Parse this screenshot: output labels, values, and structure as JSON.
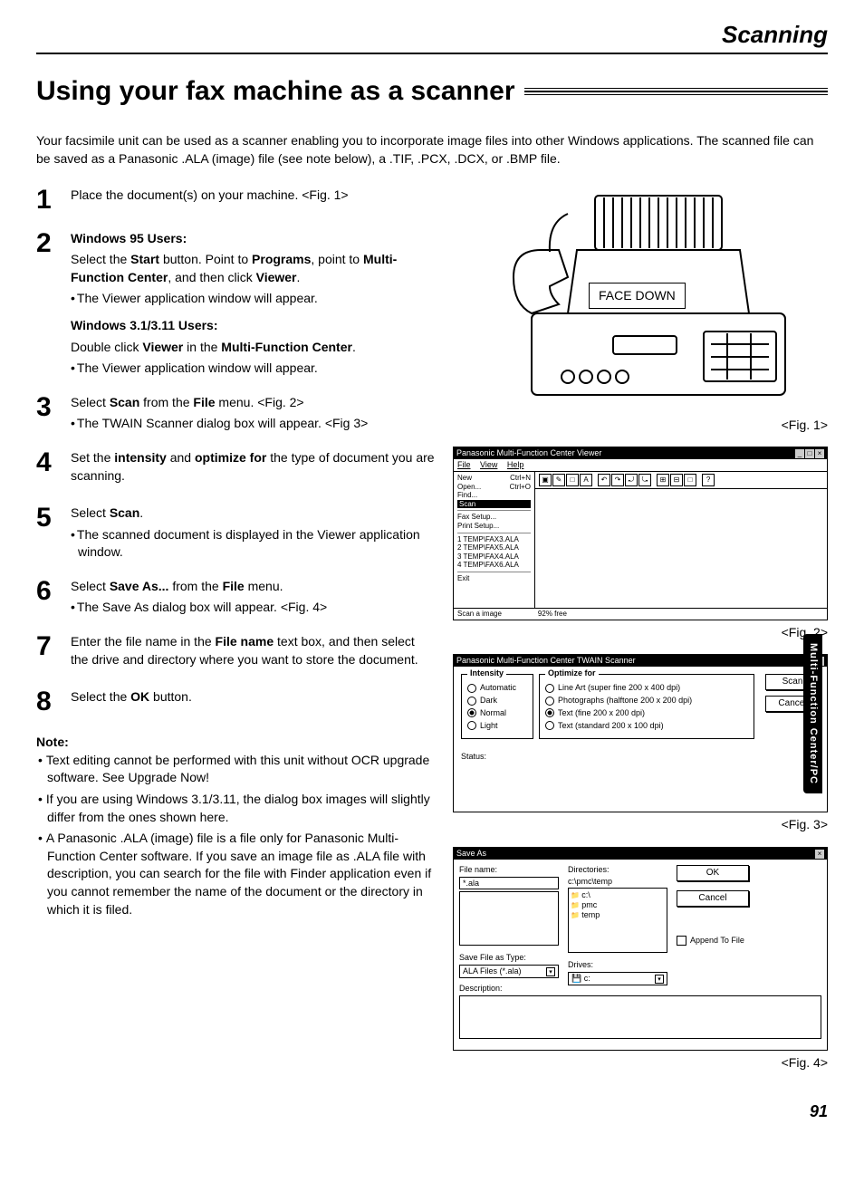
{
  "section_header": "Scanning",
  "page_title": "Using your fax machine as a scanner",
  "intro": "Your facsimile unit can be used as a scanner enabling you to incorporate image files into other Windows applications. The scanned file can be saved as a Panasonic .ALA (image) file (see note below), a .TIF, .PCX, .DCX, or .BMP file.",
  "steps": {
    "s1": {
      "num": "1",
      "text": "Place the document(s) on your machine. <Fig. 1>"
    },
    "s2": {
      "num": "2",
      "p1_lead": "Windows 95 Users:",
      "p1_a": "Select the ",
      "p1_b": " button. Point to ",
      "p1_c": ", point to ",
      "p1_d": ", and then click ",
      "p1_e": ".",
      "p1_bold1": "Start",
      "p1_bold2": "Programs",
      "p1_bold3": "Multi-Function Center",
      "p1_bold4": "Viewer",
      "p1_bullet": "The Viewer application window will appear.",
      "p2_lead": "Windows 3.1/3.11 Users:",
      "p2_a": "Double click ",
      "p2_b": " in the ",
      "p2_c": ".",
      "p2_bold1": "Viewer",
      "p2_bold2": "Multi-Function Center",
      "p2_bullet": "The Viewer application window will appear."
    },
    "s3": {
      "num": "3",
      "a": "Select ",
      "b": " from the ",
      "c": " menu. <Fig. 2>",
      "bold1": "Scan",
      "bold2": "File",
      "bullet": "The TWAIN Scanner dialog box will appear. <Fig 3>"
    },
    "s4": {
      "num": "4",
      "a": "Set the ",
      "b": " and ",
      "c": " the type of document you are scanning.",
      "bold1": "intensity",
      "bold2": "optimize for"
    },
    "s5": {
      "num": "5",
      "a": "Select ",
      "b": ".",
      "bold1": "Scan",
      "bullet": "The scanned document is displayed in the Viewer application window."
    },
    "s6": {
      "num": "6",
      "a": "Select ",
      "b": " from the ",
      "c": " menu.",
      "bold1": "Save As...",
      "bold2": "File",
      "bullet": "The Save As dialog box will appear. <Fig. 4>"
    },
    "s7": {
      "num": "7",
      "a": "Enter the file name in the ",
      "b": " text box, and then select the drive and directory where you want to store the document.",
      "bold1": "File name"
    },
    "s8": {
      "num": "8",
      "a": "Select the ",
      "b": " button.",
      "bold1": "OK"
    }
  },
  "note_head": "Note:",
  "notes": {
    "n1": "Text editing cannot be performed with this unit without OCR upgrade software. See Upgrade Now!",
    "n2": "If you are using Windows 3.1/3.11, the dialog box images will slightly differ from the ones shown here.",
    "n3": "A Panasonic .ALA (image) file is a file only for Panasonic Multi-Function Center software. If you save an image file as .ALA file with description, you can search for the file with Finder application even if you cannot remember the name of the document or the directory in which it is filed."
  },
  "fig1": {
    "face_down": "FACE DOWN",
    "caption": "<Fig. 1>"
  },
  "fig2": {
    "title": "Panasonic Multi-Function Center Viewer",
    "menu": {
      "file": "File",
      "view": "View",
      "help": "Help"
    },
    "filemenu": {
      "new": "New",
      "new_sc": "Ctrl+N",
      "open": "Open...",
      "open_sc": "Ctrl+O",
      "find": "Find...",
      "scan": "Scan",
      "faxsetup": "Fax Setup...",
      "printsetup": "Print Setup...",
      "r1": "1 TEMP\\FAX3.ALA",
      "r2": "2 TEMP\\FAX5.ALA",
      "r3": "3 TEMP\\FAX4.ALA",
      "r4": "4 TEMP\\FAX6.ALA",
      "exit": "Exit"
    },
    "status_left": "Scan a image",
    "status_right": "92% free",
    "caption": "<Fig. 2>"
  },
  "fig3": {
    "title": "Panasonic Multi-Function Center TWAIN Scanner",
    "intensity_legend": "Intensity",
    "intensity": {
      "auto": "Automatic",
      "dark": "Dark",
      "normal": "Normal",
      "light": "Light"
    },
    "optimize_legend": "Optimize for",
    "optimize": {
      "o1": "Line Art (super fine 200 x 400 dpi)",
      "o2": "Photographs (halftone 200 x 200 dpi)",
      "o3": "Text (fine 200 x 200 dpi)",
      "o4": "Text (standard 200 x 100 dpi)"
    },
    "btn_scan": "Scan",
    "btn_cancel": "Cancel",
    "status_label": "Status:",
    "caption": "<Fig. 3>"
  },
  "fig4": {
    "title": "Save As",
    "filename_label": "File name:",
    "filename_value": "*.ala",
    "directories_label": "Directories:",
    "directories_path": "c:\\pmc\\temp",
    "dir_items": {
      "d1": "c:\\",
      "d2": "pmc",
      "d3": "temp"
    },
    "savetype_label": "Save File as Type:",
    "savetype_value": "ALA Files (*.ala)",
    "drives_label": "Drives:",
    "drives_value": "c:",
    "description_label": "Description:",
    "btn_ok": "OK",
    "btn_cancel": "Cancel",
    "append": "Append To File",
    "caption": "<Fig. 4>"
  },
  "side_tab": "Multi-Function Center/PC",
  "page_number": "91"
}
